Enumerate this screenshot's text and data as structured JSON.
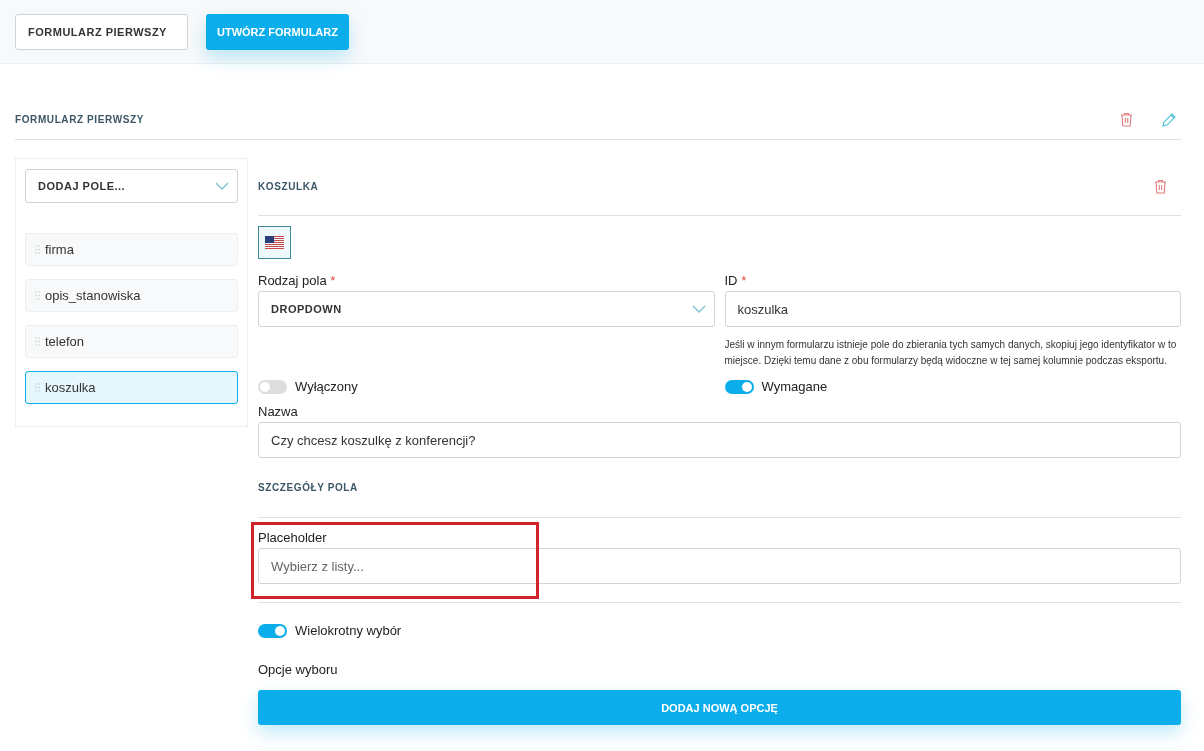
{
  "top_bar": {
    "form_select": {
      "value": "FORMULARZ PIERWSZY"
    },
    "create_button": "UTWÓRZ FORMULARZ"
  },
  "form": {
    "title": "FORMULARZ PIERWSZY",
    "add_field_select": {
      "value": "DODAJ POLE..."
    },
    "fields": [
      {
        "label": "firma",
        "selected": false
      },
      {
        "label": "opis_stanowiska",
        "selected": false
      },
      {
        "label": "telefon",
        "selected": false
      },
      {
        "label": "koszulka",
        "selected": true
      }
    ],
    "editor": {
      "title": "KOSZULKA",
      "field_type": {
        "label": "Rodzaj pola",
        "required_mark": "*",
        "value": "DROPDOWN"
      },
      "id": {
        "label": "ID",
        "required_mark": "*",
        "value": "koszulka",
        "help": "Jeśli w innym formularzu istnieje pole do zbierania tych samych danych, skopiuj jego identyfikator w to miejsce. Dzięki temu dane z obu formularzy będą widoczne w tej samej kolumnie podczas eksportu."
      },
      "disabled_toggle": {
        "label": "Wyłączony",
        "on": false
      },
      "required_toggle": {
        "label": "Wymagane",
        "on": true
      },
      "name": {
        "label": "Nazwa",
        "value": "Czy chcesz koszulkę z konferencji?"
      },
      "details_title": "SZCZEGÓŁY POLA",
      "placeholder_field": {
        "label": "Placeholder",
        "value": "Wybierz z listy..."
      },
      "multiple_toggle": {
        "label": "Wielokrotny wybór",
        "on": true
      },
      "options_label": "Opcje wyboru",
      "add_option_button": "DODAJ NOWĄ OPCJĘ"
    }
  }
}
